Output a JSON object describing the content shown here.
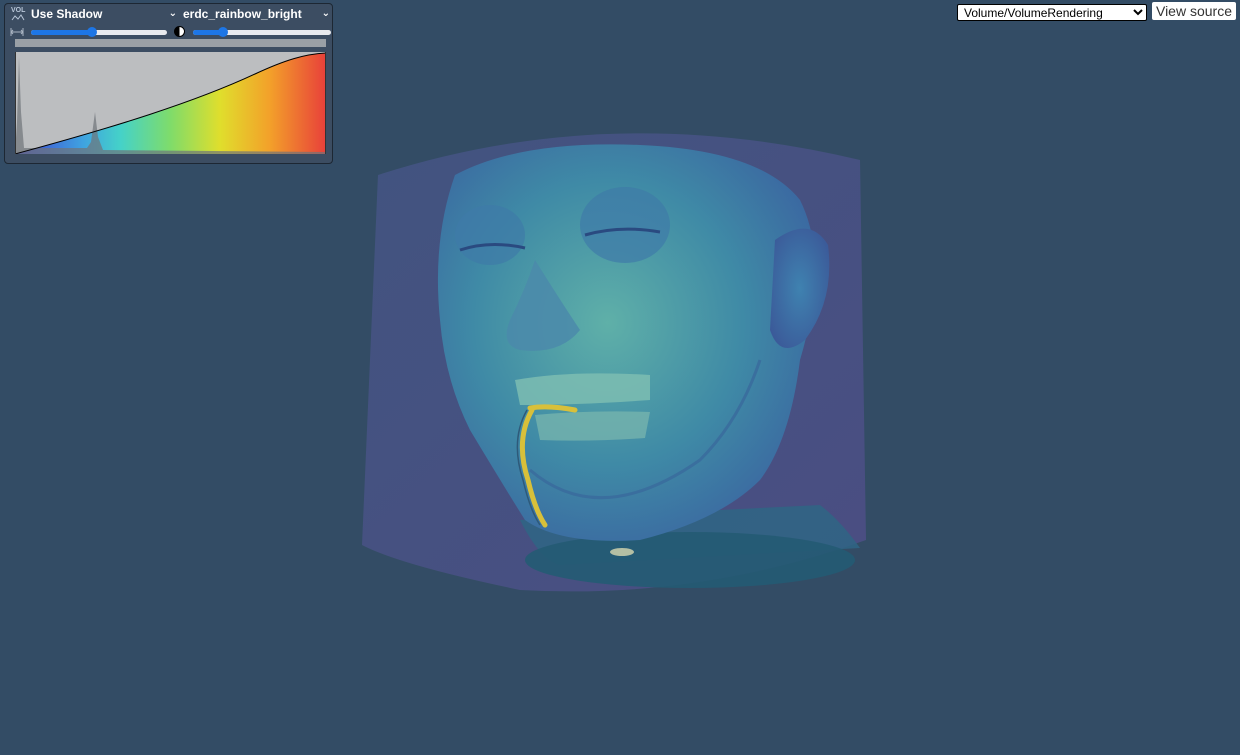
{
  "panel": {
    "preset_label": "Use Shadow",
    "colormap_label": "erdc_rainbow_bright",
    "logo_text": "VOL",
    "window_value": 0.45,
    "level_value": 0.22
  },
  "example_select": {
    "value": "Volume/VolumeRendering",
    "options": [
      "Volume/VolumeRendering"
    ]
  },
  "view_source_label": "View source",
  "colors": {
    "background": "#334c65",
    "slider_accent": "#1d76e6"
  }
}
